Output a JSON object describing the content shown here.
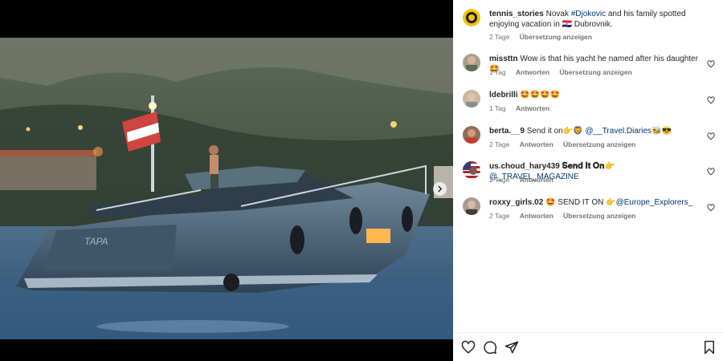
{
  "post": {
    "author": "tennis_stories",
    "caption_prefix": "Novak ",
    "caption_hashtag": "#Djokovic",
    "caption_rest": " and his family spotted enjoying vacation in 🇭🇷 Dubrovnik.",
    "time": "2 Tage",
    "translate_label": "Übersetzung anzeigen"
  },
  "comments": [
    {
      "user": "missttn",
      "text": "Wow is that his yacht he named after his daughter 🤩",
      "time": "1 Tag",
      "reply": "Antworten",
      "translate": "Übersetzung anzeigen"
    },
    {
      "user": "ldebrilli",
      "text": "🤩🤩🤩🤩",
      "time": "1 Tag",
      "reply": "Antworten",
      "translate": ""
    },
    {
      "user": "berta.__9",
      "text_prefix": "Send it on👉🦁 ",
      "mention": "@__Travel.Diaries",
      "text_suffix": "🐝😎",
      "time": "2 Tage",
      "reply": "Antworten",
      "translate": "Übersetzung anzeigen"
    },
    {
      "user": "us.choud_hary439",
      "text_prefix": "𝐒𝐞𝐧𝐝 𝐈𝐭 𝐎𝐧👉 ",
      "mention": "@_TRAVEL_MAGAZINE",
      "text_suffix": "",
      "time": "2 Tage",
      "reply": "Antworten",
      "translate": ""
    },
    {
      "user": "roxxy_girls.02",
      "text_prefix": "🤩 SEND IT ON 👉",
      "mention": "@Europe_Explorers_",
      "text_suffix": "",
      "time": "2 Tage",
      "reply": "Antworten",
      "translate": "Übersetzung anzeigen"
    }
  ],
  "icons": {
    "like": "heart-outline-icon",
    "comment": "speech-bubble-icon",
    "share": "paper-plane-icon",
    "save": "bookmark-icon",
    "next": "chevron-right-icon"
  },
  "colors": {
    "link": "#00376b",
    "muted": "#737373",
    "text": "#262626"
  },
  "boat_text": "TAPA"
}
